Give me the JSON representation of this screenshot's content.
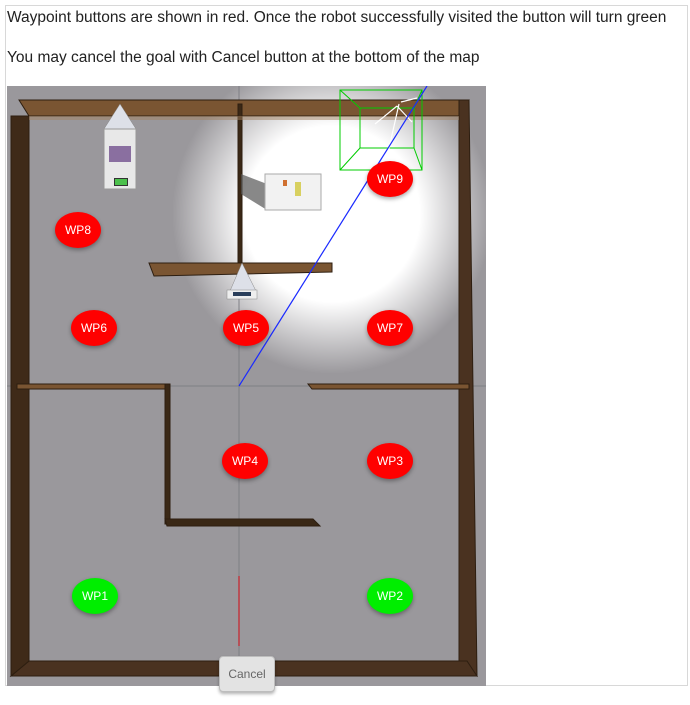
{
  "instructions": {
    "line1": "Waypoint buttons are shown in red. Once the robot successfully visited the button will turn green",
    "line2": "You may cancel the goal with Cancel button at the bottom of the map"
  },
  "waypoints": [
    {
      "label": "WP1",
      "status": "visited",
      "color": "#00ee00"
    },
    {
      "label": "WP2",
      "status": "visited",
      "color": "#00ee00"
    },
    {
      "label": "WP3",
      "status": "pending",
      "color": "#ff0000"
    },
    {
      "label": "WP4",
      "status": "pending",
      "color": "#ff0000"
    },
    {
      "label": "WP5",
      "status": "pending",
      "color": "#ff0000"
    },
    {
      "label": "WP6",
      "status": "pending",
      "color": "#ff0000"
    },
    {
      "label": "WP7",
      "status": "pending",
      "color": "#ff0000"
    },
    {
      "label": "WP8",
      "status": "pending",
      "color": "#ff0000"
    },
    {
      "label": "WP9",
      "status": "pending",
      "color": "#ff0000"
    }
  ],
  "cancel_button": {
    "label": "Cancel"
  }
}
